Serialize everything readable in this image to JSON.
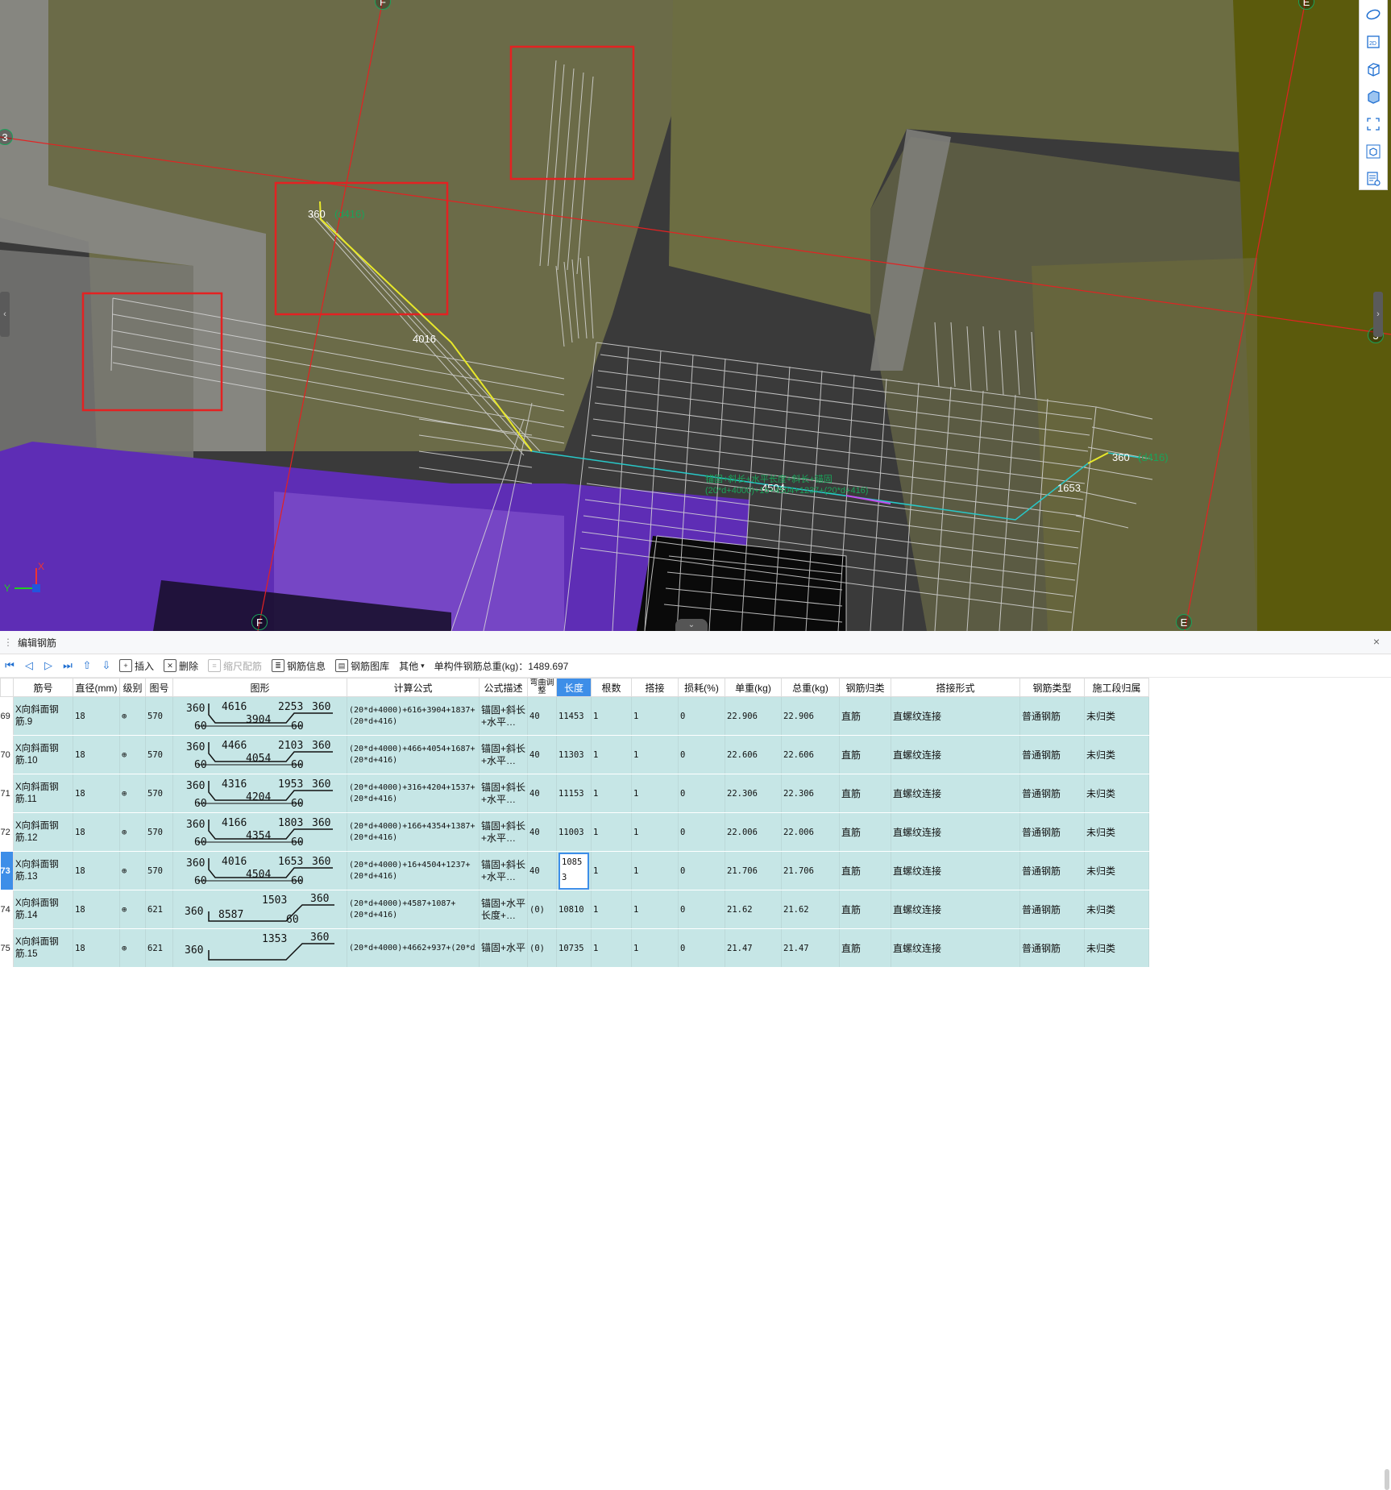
{
  "viewport": {
    "axis_labels": {
      "f_top": "F",
      "f_bottom": "F",
      "e_top": "E",
      "e_bottom": "E",
      "three_left": "3",
      "three_right": "3"
    },
    "dimension_labels": {
      "d360_a": "360",
      "d360_a_green": "(d416)",
      "d4016": "4016",
      "d360_b": "360",
      "d360_b_green": "(d416)",
      "d4504": "4504",
      "d1653": "1653",
      "green_note_1": "锚固+斜长+水平长度+斜长+锚固",
      "green_note_2": "(20*d+4000)+16+4504+1237+(20*d+416)"
    },
    "axis_indicator": {
      "x": "X",
      "y": "Y"
    },
    "toolbar_icons": [
      "orbit-icon",
      "2d-view-icon",
      "3d-box-icon",
      "view-dropdown-icon",
      "solid-box-icon",
      "view-dropdown-icon-2",
      "fullscreen-icon",
      "cube-view-icon",
      "rebar-info-icon"
    ],
    "colors": {
      "frame_red": "#e32222",
      "highlight_yellow": "#e8e82a",
      "cyan_line": "#28c8c8",
      "purple": "#6b2bc9"
    }
  },
  "panel": {
    "title": "编辑钢筋",
    "close": "×",
    "toolbar": {
      "insert": "插入",
      "delete": "删除",
      "scale": "缩尺配筋",
      "rebar_info": "钢筋信息",
      "rebar_library": "钢筋图库",
      "other": "其他",
      "other_caret": "▾",
      "total_weight": "单构件钢筋总重(kg)：1489.697"
    },
    "columns": [
      "",
      "筋号",
      "直径(mm)",
      "级别",
      "图号",
      "图形",
      "计算公式",
      "公式描述",
      "弯曲调整",
      "长度",
      "根数",
      "搭接",
      "损耗(%)",
      "单重(kg)",
      "总重(kg)",
      "钢筋归类",
      "搭接形式",
      "钢筋类型",
      "施工段归属"
    ],
    "rows": [
      {
        "rn": "69",
        "name": "X向斜面钢筋.9",
        "dia": "18",
        "grade": "⊕",
        "fig": "570",
        "s": {
          "a": "360",
          "b": "4616",
          "c": "2253",
          "d": "360",
          "e": "60",
          "f": "3904",
          "g": "60"
        },
        "formula": "(20*d+4000)+616+3904+1837+(20*d+416)",
        "desc": "锚固+斜长+水平…",
        "bend": "40",
        "len": "11453",
        "count": "1",
        "lap": "1",
        "loss": "0",
        "unit": "22.906",
        "total": "22.906",
        "cls": "直筋",
        "lapform": "直螺纹连接",
        "type": "普通钢筋",
        "seg": "未归类"
      },
      {
        "rn": "70",
        "name": "X向斜面钢筋.10",
        "dia": "18",
        "grade": "⊕",
        "fig": "570",
        "s": {
          "a": "360",
          "b": "4466",
          "c": "2103",
          "d": "360",
          "e": "60",
          "f": "4054",
          "g": "60"
        },
        "formula": "(20*d+4000)+466+4054+1687+(20*d+416)",
        "desc": "锚固+斜长+水平…",
        "bend": "40",
        "len": "11303",
        "count": "1",
        "lap": "1",
        "loss": "0",
        "unit": "22.606",
        "total": "22.606",
        "cls": "直筋",
        "lapform": "直螺纹连接",
        "type": "普通钢筋",
        "seg": "未归类"
      },
      {
        "rn": "71",
        "name": "X向斜面钢筋.11",
        "dia": "18",
        "grade": "⊕",
        "fig": "570",
        "s": {
          "a": "360",
          "b": "4316",
          "c": "1953",
          "d": "360",
          "e": "60",
          "f": "4204",
          "g": "60"
        },
        "formula": "(20*d+4000)+316+4204+1537+(20*d+416)",
        "desc": "锚固+斜长+水平…",
        "bend": "40",
        "len": "11153",
        "count": "1",
        "lap": "1",
        "loss": "0",
        "unit": "22.306",
        "total": "22.306",
        "cls": "直筋",
        "lapform": "直螺纹连接",
        "type": "普通钢筋",
        "seg": "未归类"
      },
      {
        "rn": "72",
        "name": "X向斜面钢筋.12",
        "dia": "18",
        "grade": "⊕",
        "fig": "570",
        "s": {
          "a": "360",
          "b": "4166",
          "c": "1803",
          "d": "360",
          "e": "60",
          "f": "4354",
          "g": "60"
        },
        "formula": "(20*d+4000)+166+4354+1387+(20*d+416)",
        "desc": "锚固+斜长+水平…",
        "bend": "40",
        "len": "11003",
        "count": "1",
        "lap": "1",
        "loss": "0",
        "unit": "22.006",
        "total": "22.006",
        "cls": "直筋",
        "lapform": "直螺纹连接",
        "type": "普通钢筋",
        "seg": "未归类"
      },
      {
        "rn": "73",
        "name": "X向斜面钢筋.13",
        "dia": "18",
        "grade": "⊕",
        "fig": "570",
        "s": {
          "a": "360",
          "b": "4016",
          "c": "1653",
          "d": "360",
          "e": "60",
          "f": "4504",
          "g": "60"
        },
        "formula": "(20*d+4000)+16+4504+1237+(20*d+416)",
        "desc": "锚固+斜长+水平…",
        "bend": "40",
        "len": "10853",
        "count": "1",
        "lap": "1",
        "loss": "0",
        "unit": "21.706",
        "total": "21.706",
        "cls": "直筋",
        "lapform": "直螺纹连接",
        "type": "普通钢筋",
        "seg": "未归类",
        "selected": true
      },
      {
        "rn": "74",
        "name": "X向斜面钢筋.14",
        "dia": "18",
        "grade": "⊕",
        "fig": "621",
        "s2": {
          "a": "360",
          "b": "1503",
          "c": "360",
          "d": "8587",
          "e": "60"
        },
        "formula": "(20*d+4000)+4587+1087+(20*d+416)",
        "desc": "锚固+水平长度+…",
        "bend": "(0)",
        "len": "10810",
        "count": "1",
        "lap": "1",
        "loss": "0",
        "unit": "21.62",
        "total": "21.62",
        "cls": "直筋",
        "lapform": "直螺纹连接",
        "type": "普通钢筋",
        "seg": "未归类"
      },
      {
        "rn": "75",
        "name": "X向斜面钢筋.15",
        "dia": "18",
        "grade": "⊕",
        "fig": "621",
        "s2": {
          "a": "360",
          "b": "1353",
          "c": "360",
          "d": "",
          "e": ""
        },
        "formula": "(20*d+4000)+4662+937+(20*d",
        "desc": "锚固+水平",
        "bend": "(0)",
        "len": "10735",
        "count": "1",
        "lap": "1",
        "loss": "0",
        "unit": "21.47",
        "total": "21.47",
        "cls": "直筋",
        "lapform": "直螺纹连接",
        "type": "普通钢筋",
        "seg": "未归类"
      }
    ]
  }
}
